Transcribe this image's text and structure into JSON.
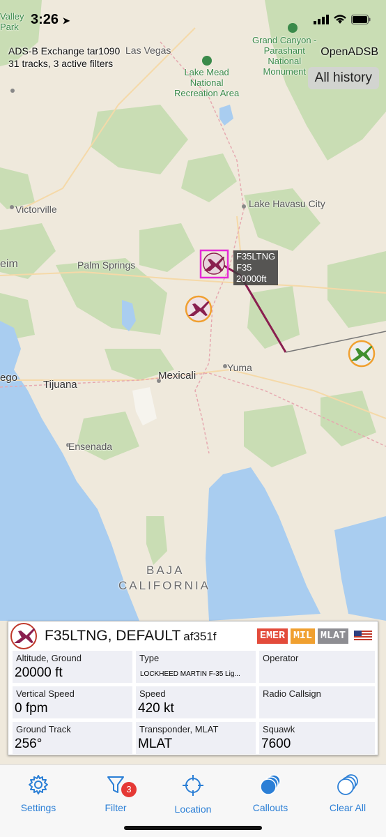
{
  "status_bar": {
    "time": "3:26"
  },
  "map": {
    "labels": {
      "valley_park": "Valley\nPark",
      "las_vegas": "Las Vegas",
      "grand_canyon": "Grand Canyon -\nParashant\nNational\nMonument",
      "lake_mead": "Lake Mead\nNational\nRecreation Area",
      "victorville": "Victorville",
      "lake_havasu": "Lake Havasu City",
      "palm_springs": "Palm Springs",
      "yuma": "Yuma",
      "mexicali": "Mexicali",
      "tijuana": "Tijuana",
      "ensenada": "Ensenada",
      "diego": "ego",
      "eim": "eim",
      "baja": "BAJA",
      "california": "CALIFORNIA"
    },
    "source_line": "ADS-B Exchange tar1090",
    "tracks_line": "31 tracks, 3 active filters",
    "app_name": "OpenADSB",
    "history_button": "All history",
    "callout": {
      "line1": "F35LTNG",
      "line2": "F35",
      "line3": "20000ft"
    }
  },
  "card": {
    "title": "F35LTNG, DEFAULT",
    "hex": "af351f",
    "badges": [
      {
        "label": "EMER",
        "color": "#e34b3b"
      },
      {
        "label": "MIL",
        "color": "#f0a030"
      },
      {
        "label": "MLAT",
        "color": "#8e8e93"
      }
    ],
    "flag_icon": "us-flag-icon",
    "fields": [
      {
        "label": "Altitude, Ground",
        "value": "20000 ft"
      },
      {
        "label": "Type",
        "value": "LOCKHEED MARTIN F-35 Lig..."
      },
      {
        "label": "Operator",
        "value": ""
      },
      {
        "label": "Vertical Speed",
        "value": "0 fpm"
      },
      {
        "label": "Speed",
        "value": "420 kt"
      },
      {
        "label": "Radio Callsign",
        "value": ""
      },
      {
        "label": "Ground Track",
        "value": "256°"
      },
      {
        "label": "Transponder, MLAT",
        "value": "MLAT"
      },
      {
        "label": "Squawk",
        "value": "7600"
      }
    ]
  },
  "tabbar": {
    "settings": "Settings",
    "filter": "Filter",
    "filter_badge": "3",
    "location": "Location",
    "callouts": "Callouts",
    "clear_all": "Clear All"
  },
  "colors": {
    "accent": "#2b7fd6",
    "selected_aircraft": "#8a1f4f",
    "mil_ring": "#f0a030",
    "green_aircraft": "#3f8f2e",
    "selection_box": "#e52bd6",
    "water": "#a9cdf0",
    "land": "#efe9dc",
    "vegetation": "#c9ddb4"
  }
}
